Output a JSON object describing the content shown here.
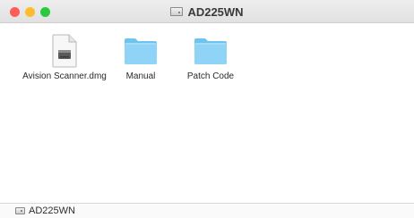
{
  "window": {
    "title": "AD225WN",
    "title_icon": "drive-icon",
    "traffic_lights": {
      "close_color": "#fd5e57",
      "minimize_color": "#febb2e",
      "zoom_color": "#2ac940"
    }
  },
  "items": [
    {
      "label": "Avision Scanner.dmg",
      "icon": "disk-image-icon"
    },
    {
      "label": "Manual",
      "icon": "folder-icon"
    },
    {
      "label": "Patch Code",
      "icon": "folder-icon"
    }
  ],
  "pathbar": {
    "label": "AD225WN",
    "icon": "drive-icon"
  },
  "colors": {
    "folder_light": "#8fd3f7",
    "folder_dark": "#6ec3f0"
  }
}
